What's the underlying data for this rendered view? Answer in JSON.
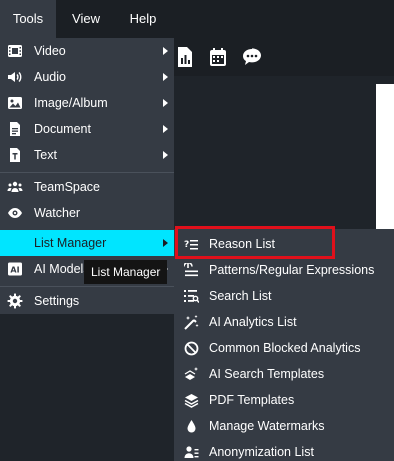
{
  "menubar": {
    "tools": "Tools",
    "view": "View",
    "help": "Help"
  },
  "tools_menu": {
    "items": [
      {
        "label": "Video",
        "icon": "film-icon",
        "submenu": true
      },
      {
        "label": "Audio",
        "icon": "speaker-icon",
        "submenu": true
      },
      {
        "label": "Image/Album",
        "icon": "image-icon",
        "submenu": true
      },
      {
        "label": "Document",
        "icon": "document-icon",
        "submenu": true
      },
      {
        "label": "Text",
        "icon": "text-icon",
        "submenu": true
      },
      {
        "label": "TeamSpace",
        "icon": "team-icon",
        "submenu": false
      },
      {
        "label": "Watcher",
        "icon": "eye-icon",
        "submenu": false
      },
      {
        "label": "List Manager",
        "icon": "",
        "submenu": true,
        "active": true
      },
      {
        "label": "AI Models",
        "icon": "ai-icon",
        "submenu": true
      },
      {
        "label": "Settings",
        "icon": "gear-icon",
        "submenu": false
      }
    ]
  },
  "tooltip": "List Manager",
  "list_manager_menu": {
    "items": [
      {
        "label": "Reason List",
        "icon": "reason-list-icon",
        "highlighted": true
      },
      {
        "label": "Patterns/Regular Expressions",
        "icon": "patterns-icon"
      },
      {
        "label": "Search List",
        "icon": "search-list-icon"
      },
      {
        "label": "AI Analytics List",
        "icon": "ai-analytics-icon"
      },
      {
        "label": "Common Blocked Analytics",
        "icon": "blocked-icon"
      },
      {
        "label": "AI Search Templates",
        "icon": "ai-search-icon"
      },
      {
        "label": "PDF Templates",
        "icon": "layers-icon"
      },
      {
        "label": "Manage Watermarks",
        "icon": "droplet-icon"
      },
      {
        "label": "Anonymization List",
        "icon": "user-list-icon"
      }
    ]
  },
  "colors": {
    "menu_bg": "#353b44",
    "active_bg": "#00e5ff",
    "highlight_border": "#e0101b",
    "toolbar_bg": "#1b1f24"
  }
}
